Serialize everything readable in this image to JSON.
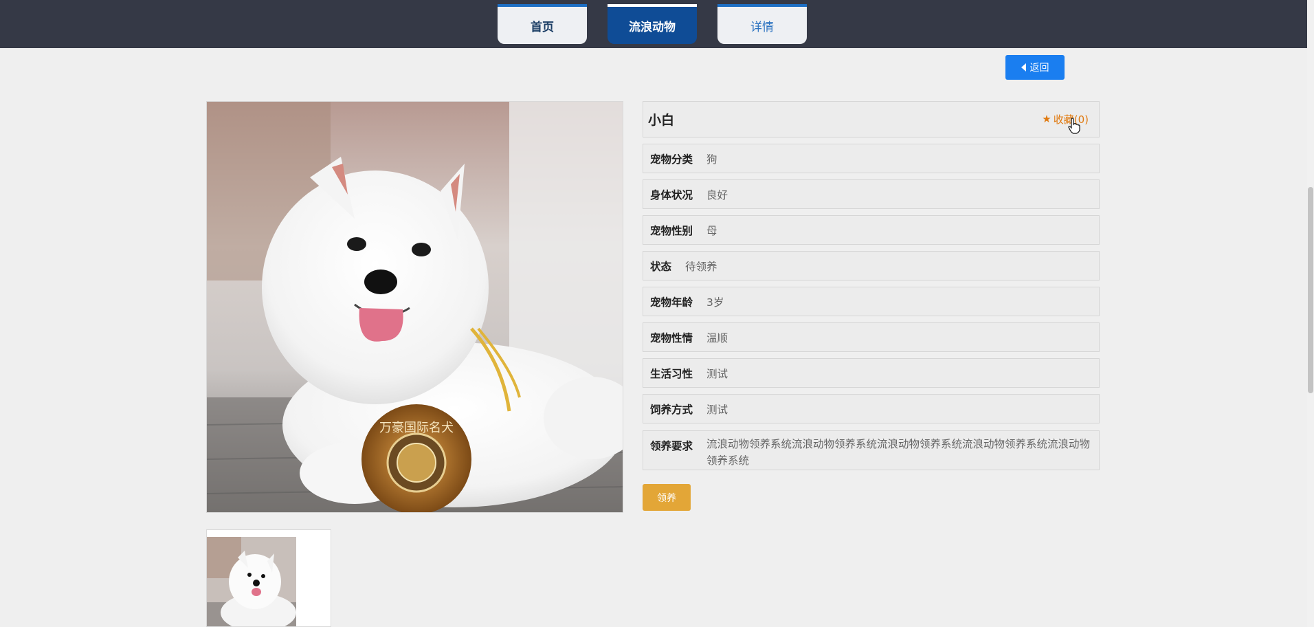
{
  "nav": {
    "tabs": [
      {
        "label": "首页"
      },
      {
        "label": "流浪动物"
      },
      {
        "label": "详情"
      }
    ]
  },
  "back_button": {
    "label": "返回"
  },
  "pet": {
    "name": "小白",
    "favorite_label": "收藏(0)",
    "fields": [
      {
        "label": "宠物分类",
        "value": "狗"
      },
      {
        "label": "身体状况",
        "value": "良好"
      },
      {
        "label": "宠物性别",
        "value": "母"
      },
      {
        "label": "状态",
        "value": "待领养"
      },
      {
        "label": "宠物年龄",
        "value": "3岁"
      },
      {
        "label": "宠物性情",
        "value": "温顺"
      },
      {
        "label": "生活习性",
        "value": "测试"
      },
      {
        "label": "饲养方式",
        "value": "测试"
      },
      {
        "label": "领养要求",
        "value": "流浪动物领养系统流浪动物领养系统流浪动物领养系统流浪动物领养系统流浪动物领养系统"
      }
    ]
  },
  "adopt_button": {
    "label": "领养"
  },
  "photo": {
    "medal_text": "万豪国际名犬"
  },
  "colors": {
    "topbar": "#353946",
    "active_tab": "#0f4c96",
    "back_button": "#1a7ef0",
    "favorite": "#e07a10",
    "adopt_button": "#e3a637"
  }
}
